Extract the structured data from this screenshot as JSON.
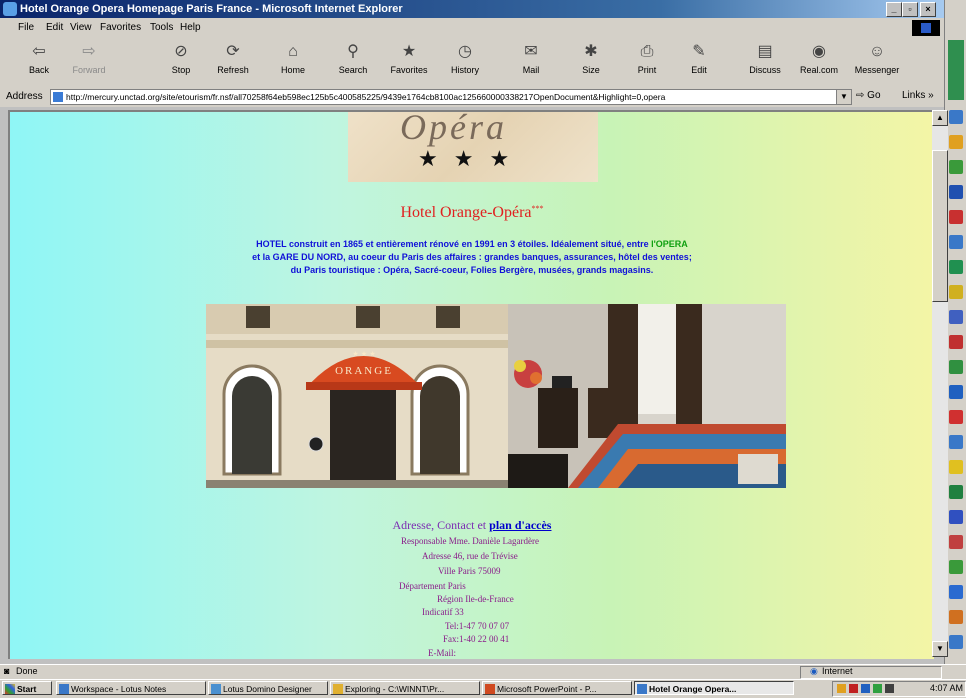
{
  "window": {
    "title": "Hotel Orange Opera Homepage Paris France - Microsoft Internet Explorer"
  },
  "menu": [
    "File",
    "Edit",
    "View",
    "Favorites",
    "Tools",
    "Help"
  ],
  "toolbar": [
    {
      "label": "Back",
      "icon": "back-arrow-icon",
      "glyph": "⇦"
    },
    {
      "label": "Forward",
      "icon": "forward-arrow-icon",
      "glyph": "⇨"
    },
    {
      "label": "Stop",
      "icon": "stop-icon",
      "glyph": "⊘"
    },
    {
      "label": "Refresh",
      "icon": "refresh-icon",
      "glyph": "⟳"
    },
    {
      "label": "Home",
      "icon": "home-icon",
      "glyph": "⌂"
    },
    {
      "label": "Search",
      "icon": "search-icon",
      "glyph": "⚲"
    },
    {
      "label": "Favorites",
      "icon": "favorites-icon",
      "glyph": "★"
    },
    {
      "label": "History",
      "icon": "history-icon",
      "glyph": "◷"
    },
    {
      "label": "Mail",
      "icon": "mail-icon",
      "glyph": "✉"
    },
    {
      "label": "Size",
      "icon": "size-icon",
      "glyph": "✱"
    },
    {
      "label": "Print",
      "icon": "print-icon",
      "glyph": "⎙"
    },
    {
      "label": "Edit",
      "icon": "edit-icon",
      "glyph": "✎"
    },
    {
      "label": "Discuss",
      "icon": "discuss-icon",
      "glyph": "▤"
    },
    {
      "label": "Real.com",
      "icon": "realcom-icon",
      "glyph": "◉"
    },
    {
      "label": "Messenger",
      "icon": "messenger-icon",
      "glyph": "☺"
    }
  ],
  "address": {
    "label": "Address",
    "url": "http://mercury.unctad.org/site/etourism/fr.nsf/all70258f64eb598ec125b5c400585225/9439e1764cb8100ac125660000338217OpenDocument&Highlight=0,opera",
    "go": "Go",
    "links": "Links"
  },
  "page": {
    "logo_script": "Opéra",
    "logo_stars": "★★★",
    "hotel_name": "Hotel Orange-Opéra",
    "hotel_stars": "***",
    "desc_line1a": "HOTEL construit en 1865 et entièrement rénové en 1991 en 3 étoiles. Idéalement situé, entre ",
    "desc_line1b": "l'OPERA",
    "desc_line2": "et la GARE DU NORD, au coeur du Paris des affaires : grandes banques, assurances, hôtel des ventes;",
    "desc_line3": "du Paris touristique : Opéra, Sacré-coeur, Folies Bergère, musées, grands magasins.",
    "facade_sign": "ORANGE",
    "contact_title": "Adresse, Contact et ",
    "contact_link": "plan d'accès",
    "lines": [
      "Responsable Mme. Danièle Lagardère",
      "Adresse 46, rue de Trévise",
      "Ville Paris 75009",
      "Département Paris",
      "Région Ile-de-France",
      "Indicatif 33",
      "Tel:1-47 70 07 07",
      "Fax:1-40 22 00 41",
      "E-Mail:"
    ]
  },
  "status": {
    "left": "Done",
    "zone": "Internet"
  },
  "taskbar": {
    "start": "Start",
    "items": [
      "Workspace - Lotus Notes",
      "Lotus Domino Designer",
      "Exploring - C:\\WINNT\\Pr...",
      "Microsoft PowerPoint - P...",
      "Hotel Orange Opera..."
    ],
    "clock": "4:07 AM"
  },
  "colors": {
    "title_red": "#e02020",
    "desc_blue": "#1010d8",
    "desc_green": "#10a010",
    "link_blue": "#0000cc"
  }
}
